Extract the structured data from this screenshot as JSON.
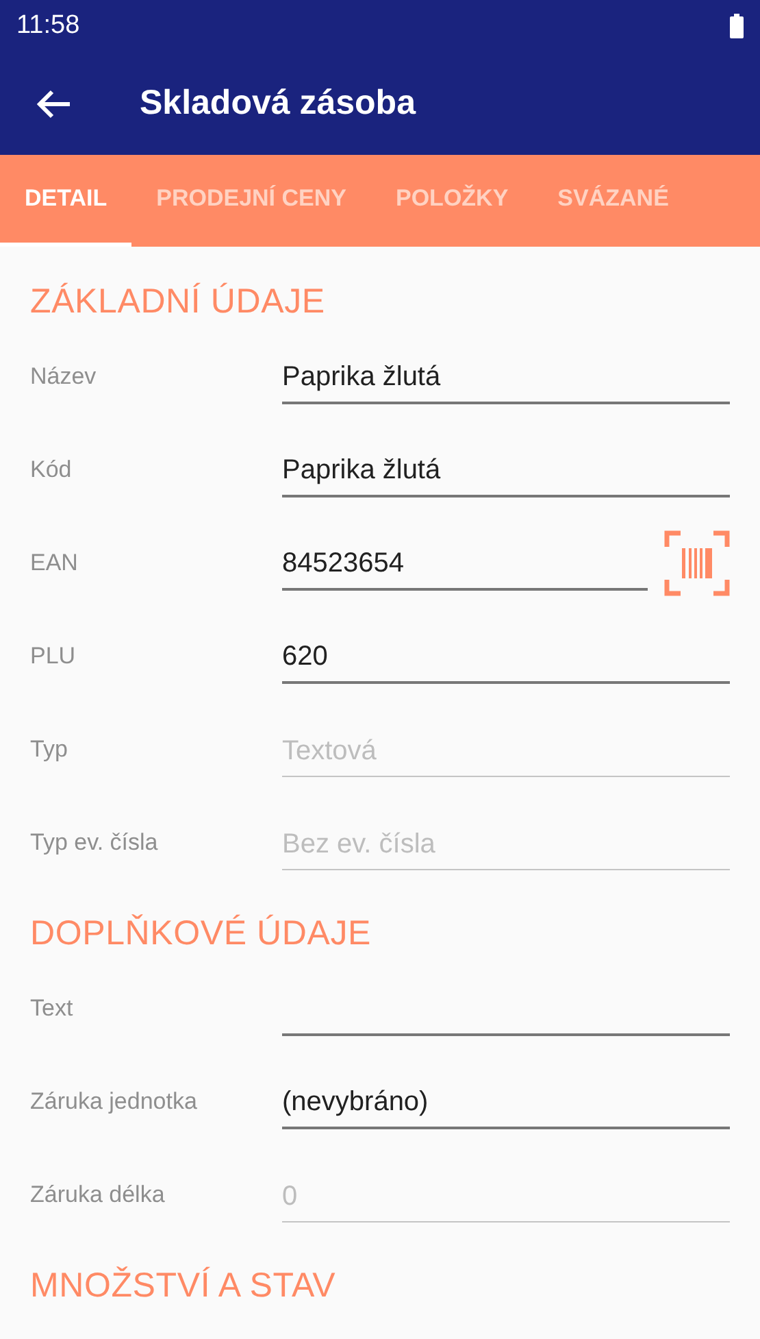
{
  "status_bar": {
    "time": "11:58"
  },
  "app_bar": {
    "title": "Skladová zásoba"
  },
  "tabs": [
    {
      "label": "DETAIL",
      "selected": true
    },
    {
      "label": "PRODEJNÍ CENY",
      "selected": false
    },
    {
      "label": "POLOŽKY",
      "selected": false
    },
    {
      "label": "SVÁZANÉ",
      "selected": false
    }
  ],
  "sections": [
    {
      "title": "ZÁKLADNÍ ÚDAJE",
      "fields": [
        {
          "label": "Název",
          "value": "Paprika žlutá",
          "disabled": false
        },
        {
          "label": "Kód",
          "value": "Paprika žlutá",
          "disabled": false
        },
        {
          "label": "EAN",
          "value": "84523654",
          "disabled": false,
          "scan": true
        },
        {
          "label": "PLU",
          "value": "620",
          "disabled": false
        },
        {
          "label": "Typ",
          "value": "Textová",
          "disabled": true
        },
        {
          "label": "Typ ev. čísla",
          "value": "Bez ev. čísla",
          "disabled": true
        }
      ]
    },
    {
      "title": "DOPLŇKOVÉ ÚDAJE",
      "fields": [
        {
          "label": "Text",
          "disabled": false
        },
        {
          "label": "Záruka jednotka",
          "value": "(nevybráno)",
          "disabled": false
        },
        {
          "label": "Záruka délka",
          "value": "0",
          "disabled": true
        }
      ]
    },
    {
      "title": "MNOŽSTVÍ A STAV"
    }
  ]
}
